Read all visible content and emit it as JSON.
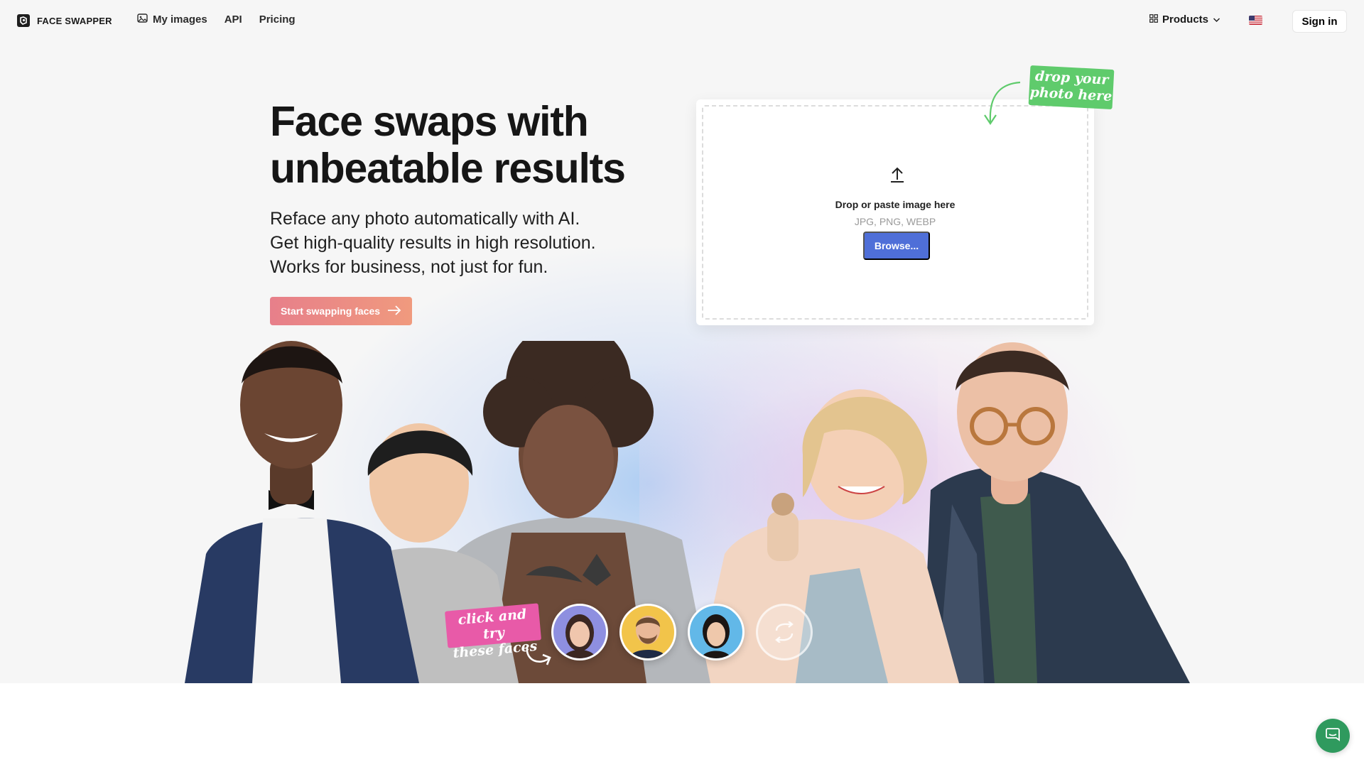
{
  "header": {
    "brand": "FACE SWAPPER",
    "nav": [
      {
        "label": "My images",
        "icon": "image-icon"
      },
      {
        "label": "API"
      },
      {
        "label": "Pricing"
      }
    ],
    "products_label": "Products",
    "language_flag": "us-flag",
    "signin_label": "Sign in"
  },
  "hero": {
    "title_line1": "Face swaps with",
    "title_line2": "unbeatable results",
    "subtitle_lines": [
      "Reface any photo automatically with AI.",
      "Get high-quality results in high resolution.",
      "Works for business, not just for fun."
    ],
    "cta_label": "Start swapping faces"
  },
  "upload": {
    "note_line1": "drop your",
    "note_line2": "photo here",
    "title": "Drop or paste image here",
    "formats": "JPG, PNG, WEBP",
    "browse_label": "Browse..."
  },
  "samples": {
    "note_line1": "click and try",
    "note_line2": "these faces",
    "faces": [
      "sample-face-woman-brunette",
      "sample-face-man-bearded",
      "sample-face-woman-asian"
    ],
    "shuffle_icon": "shuffle-icon"
  },
  "colors": {
    "cta_gradient_start": "#e77f8a",
    "cta_gradient_end": "#f09a7e",
    "browse": "#4f6fd8",
    "drop_note": "#5fcb6c",
    "try_note": "#e85aa8",
    "chat": "#2f9a5e"
  }
}
